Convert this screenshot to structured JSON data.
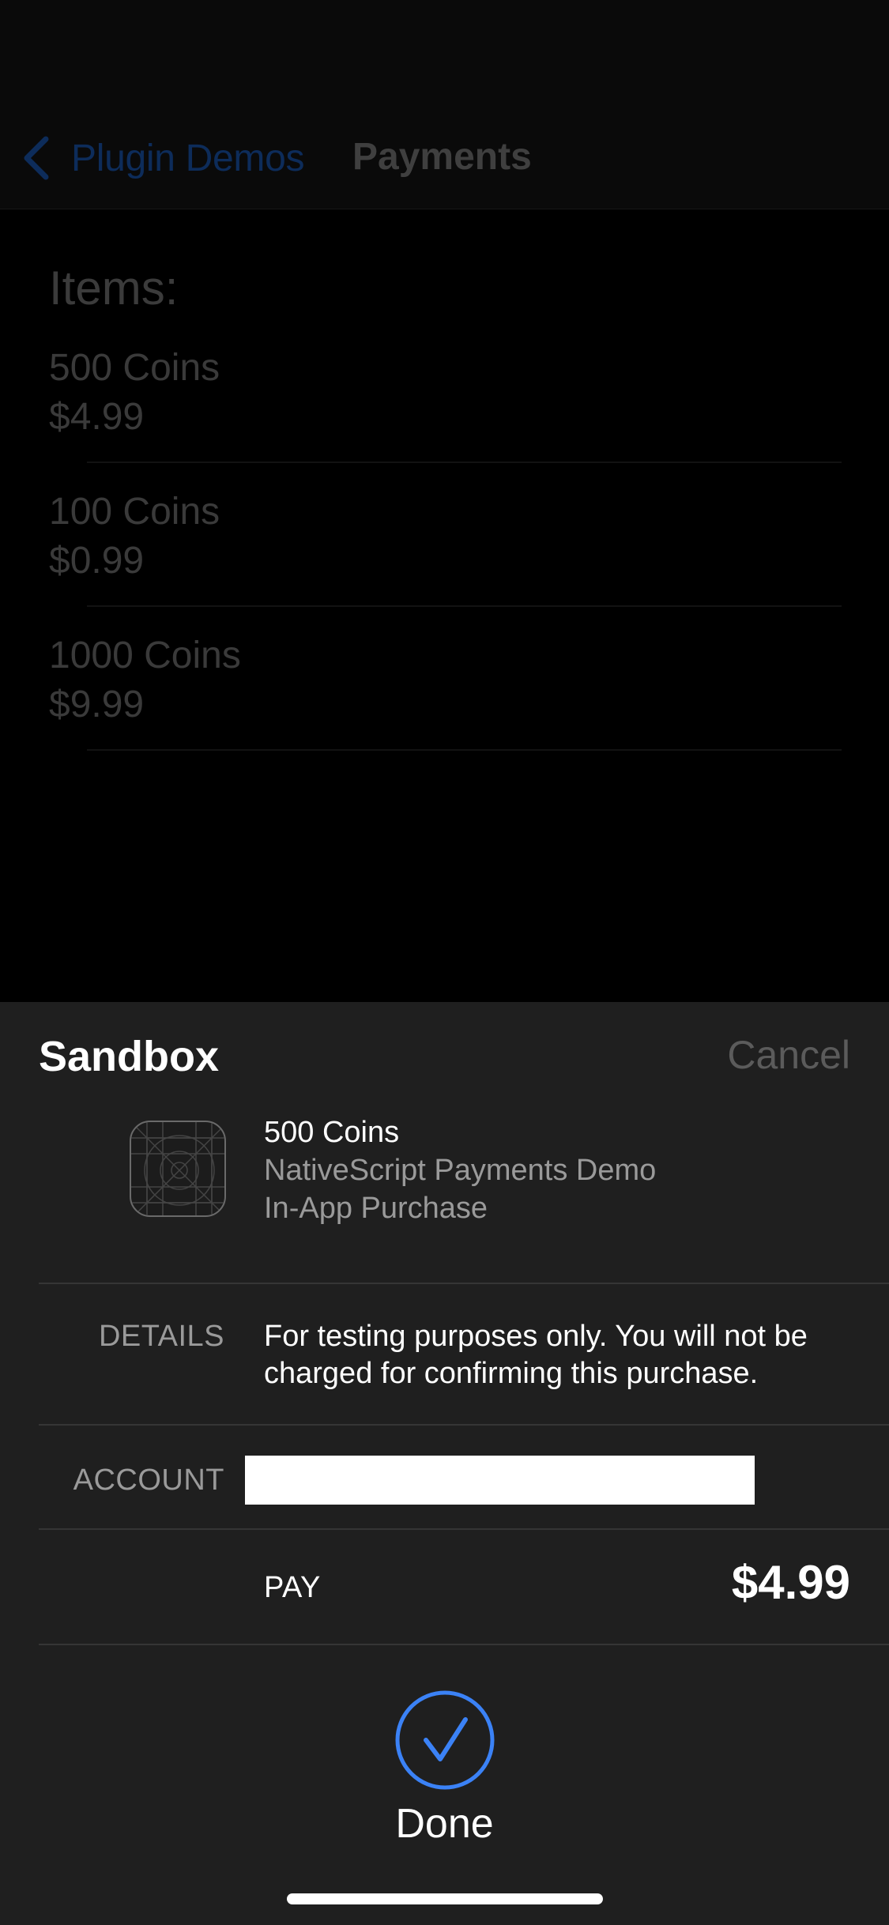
{
  "navbar": {
    "back_label": "Plugin Demos",
    "title": "Payments"
  },
  "main": {
    "heading": "Items:",
    "items": [
      {
        "name": "500 Coins",
        "price": "$4.99"
      },
      {
        "name": "100 Coins",
        "price": "$0.99"
      },
      {
        "name": "1000 Coins",
        "price": "$9.99"
      }
    ]
  },
  "sheet": {
    "title": "Sandbox",
    "cancel_label": "Cancel",
    "product": {
      "name": "500 Coins",
      "app_name": "NativeScript Payments Demo",
      "type": "In-App Purchase"
    },
    "details_label": "DETAILS",
    "details_text": "For testing purposes only. You will not be charged for confirming this purchase.",
    "account_label": "ACCOUNT",
    "account_value": "",
    "pay_label": "PAY",
    "pay_amount": "$4.99",
    "done_label": "Done"
  },
  "colors": {
    "accent": "#3b82f6",
    "sheet_background": "#1f1f1f",
    "background": "#000000"
  },
  "icons": {
    "back": "chevron-left-icon",
    "app": "app-icon-placeholder",
    "done": "checkmark-circle-icon"
  }
}
